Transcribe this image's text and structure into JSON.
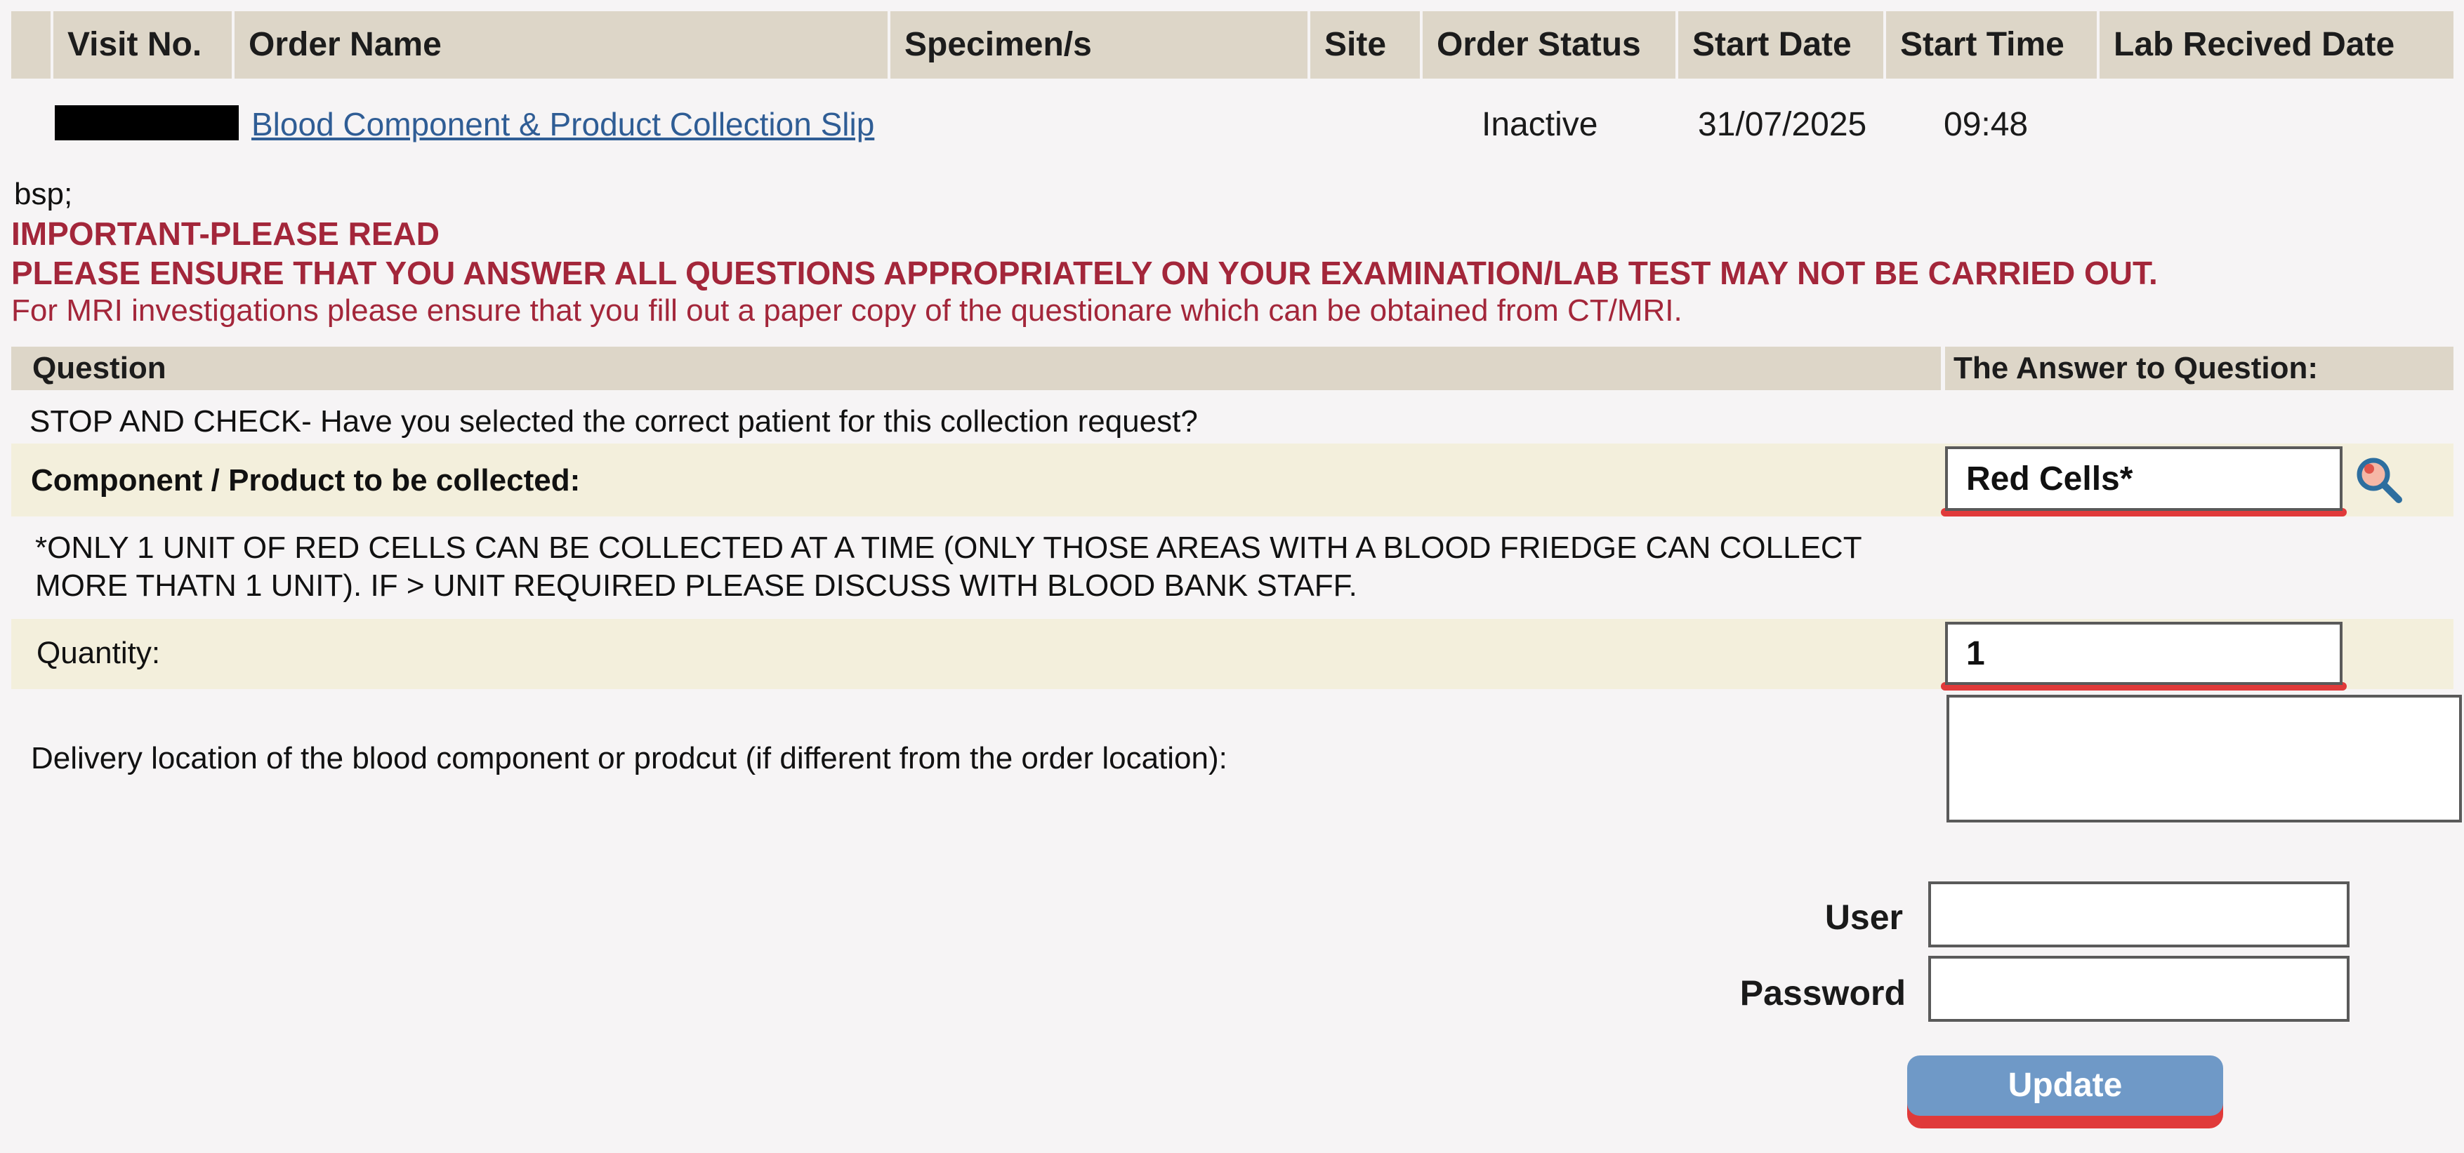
{
  "order_table": {
    "columns": [
      "",
      "Visit No.",
      "Order Name",
      "Specimen/s",
      "Site",
      "Order Status",
      "Start Date",
      "Start Time",
      "Lab Recived Date"
    ],
    "row": {
      "order_name": "Blood Component & Product Collection Slip",
      "order_status": "Inactive",
      "start_date": "31/07/2025",
      "start_time": "09:48"
    }
  },
  "notice": {
    "stray_text": "bsp;",
    "heading": "IMPORTANT-PLEASE READ",
    "warning": "PLEASE ENSURE THAT YOU ANSWER ALL QUESTIONS APPROPRIATELY ON YOUR EXAMINATION/LAB TEST MAY NOT BE CARRIED OUT.",
    "mri_note": "For MRI investigations please ensure that you fill out a paper copy of the questionare which can be obtained from CT/MRI."
  },
  "questions": {
    "header_question": "Question",
    "header_answer": "The Answer to Question:",
    "stop_check": "STOP AND CHECK- Have you selected the correct patient for this collection request?",
    "component_label": "Component / Product to be collected:",
    "component_value": "Red Cells*",
    "red_cells_note_line1": "*ONLY 1 UNIT OF RED CELLS CAN BE COLLECTED AT A TIME (ONLY THOSE AREAS WITH A BLOOD FRIEDGE CAN COLLECT",
    "red_cells_note_line2": "MORE THATN 1 UNIT). IF > UNIT REQUIRED PLEASE DISCUSS WITH BLOOD BANK STAFF.",
    "quantity_label": "Quantity:",
    "quantity_value": "1",
    "delivery_label": "Delivery location of the blood component or prodcut (if different from the order location):",
    "delivery_value": ""
  },
  "credentials": {
    "user_label": "User",
    "password_label": "Password",
    "user_value": "",
    "password_value": "",
    "update_label": "Update"
  },
  "icons": {
    "search": "magnifier-search-icon"
  },
  "colors": {
    "header_bg": "#ddd6c8",
    "warning_text": "#a3263a",
    "link": "#2f5d95",
    "highlight_underline": "#e03a3a",
    "button_bg": "#6f99c7",
    "shaded_row": "#f3efdc"
  }
}
